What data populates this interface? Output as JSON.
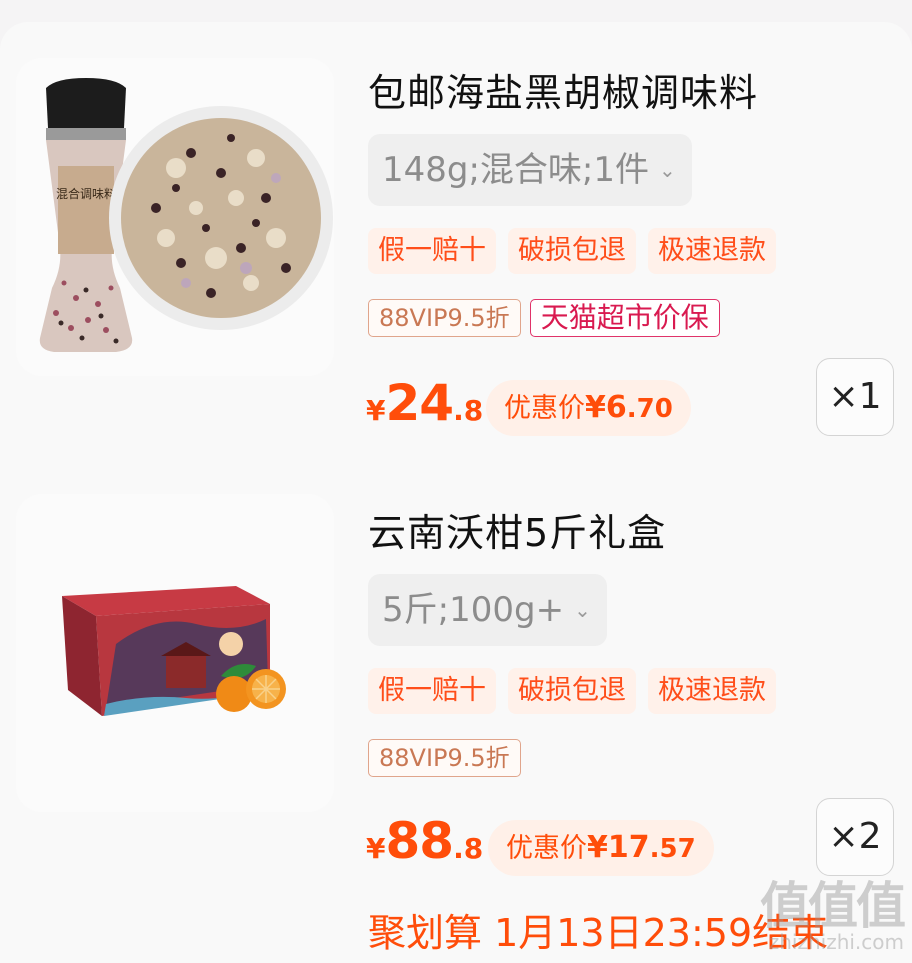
{
  "items": [
    {
      "title": "包邮海盐黑胡椒调味料",
      "sku": "148g;混合味;1件",
      "services": [
        "假一赔十",
        "破损包退",
        "极速退款"
      ],
      "tags": [
        "88VIP9.5折",
        "天猫超市价保"
      ],
      "price": {
        "symbol": "¥",
        "integer": "24",
        "decimal": ".8"
      },
      "deal": {
        "label": "优惠价",
        "symbol": "¥",
        "integer": "6",
        "decimal": ".70"
      },
      "quantity": "×1",
      "image_label": "混合调味料"
    },
    {
      "title": "云南沃柑5斤礼盒",
      "sku": "5斤;100g+",
      "services": [
        "假一赔十",
        "破损包退",
        "极速退款"
      ],
      "tags": [
        "88VIP9.5折"
      ],
      "price": {
        "symbol": "¥",
        "integer": "88",
        "decimal": ".8"
      },
      "deal": {
        "label": "优惠价",
        "symbol": "¥",
        "integer": "17",
        "decimal": ".57"
      },
      "quantity": "×2"
    }
  ],
  "promo": "聚划算 1月13日23:59结束",
  "watermark": {
    "glyphs": "值值值",
    "site": "zhizhizhi.com"
  },
  "colors": {
    "accent": "#ff4d0a",
    "guarantee": "#d91a50",
    "vip": "#c97854"
  }
}
